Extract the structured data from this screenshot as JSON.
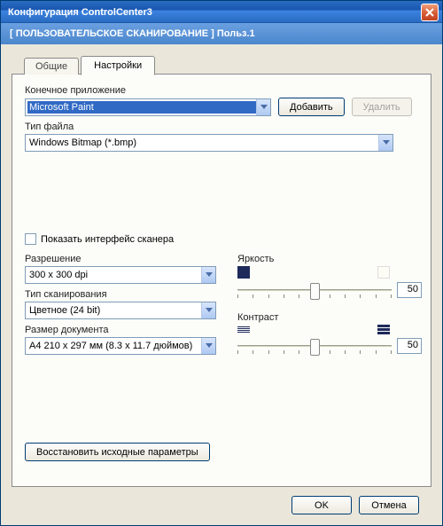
{
  "window": {
    "title": "Конфигурация ControlCenter3"
  },
  "subheader": "[  ПОЛЬЗОВАТЕЛЬСКОЕ СКАНИРОВАНИЕ  ]   Польз.1",
  "tabs": {
    "general": "Общие",
    "settings": "Настройки"
  },
  "labels": {
    "target_app": "Конечное приложение",
    "file_type": "Тип файла",
    "show_interface": "Показать интерфейс сканера",
    "resolution": "Разрешение",
    "scan_type": "Тип сканирования",
    "doc_size": "Размер документа",
    "brightness": "Яркость",
    "contrast": "Контраст"
  },
  "values": {
    "target_app": "Microsoft Paint",
    "file_type": "Windows Bitmap (*.bmp)",
    "resolution": "300 x 300 dpi",
    "scan_type": "Цветное (24 bit)",
    "doc_size": "A4 210 x 297 мм  (8.3 x 11.7 дюймов)",
    "brightness": "50",
    "contrast": "50"
  },
  "buttons": {
    "add": "Добавить",
    "remove": "Удалить",
    "restore": "Восстановить исходные параметры",
    "ok": "OK",
    "cancel": "Отмена"
  }
}
